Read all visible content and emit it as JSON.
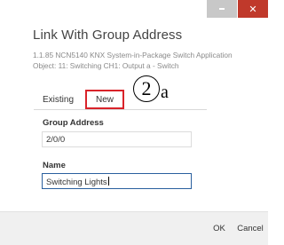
{
  "window": {
    "minimize_icon": "minimize-icon",
    "close_icon": "close-icon",
    "close_glyph": "✕",
    "close_color": "#c0392b"
  },
  "dialog": {
    "title": "Link With Group Address",
    "device_line": "1.1.85 NCN5140 KNX System-in-Package Switch Application",
    "object_line": "Object: 11: Switching CH1: Output a - Switch"
  },
  "tabs": [
    {
      "label": "Existing",
      "selected": false
    },
    {
      "label": "New",
      "selected": true
    }
  ],
  "annotation": {
    "number": "2",
    "letter": "a",
    "highlight_color": "#d9232a"
  },
  "form": {
    "group_address": {
      "label": "Group Address",
      "value": "2/0/0"
    },
    "name": {
      "label": "Name",
      "value": "Switching Lights"
    }
  },
  "buttons": {
    "ok": "OK",
    "cancel": "Cancel"
  }
}
